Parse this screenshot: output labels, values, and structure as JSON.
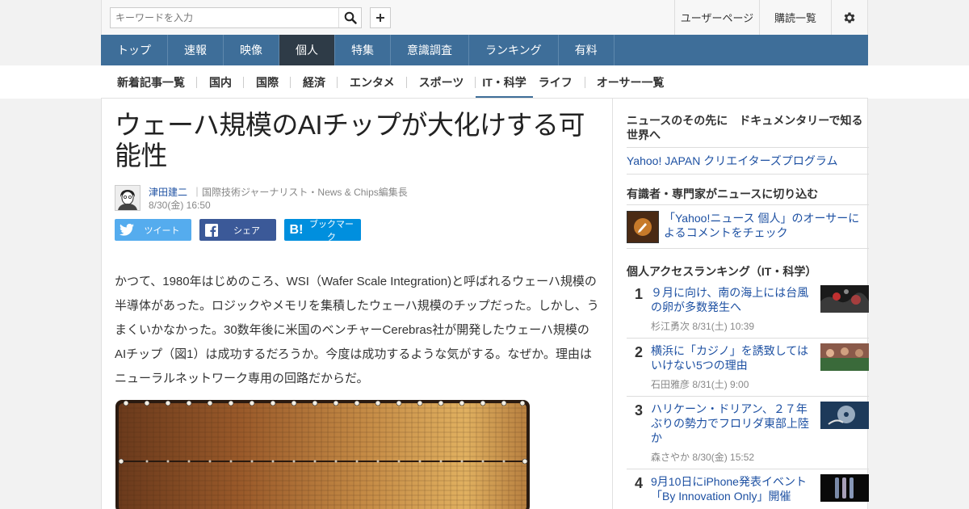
{
  "topbar": {
    "search_placeholder": "キーワードを入力",
    "user_page": "ユーザーページ",
    "subscriptions": "購読一覧"
  },
  "nav": {
    "items": [
      {
        "label": "トップ"
      },
      {
        "label": "速報"
      },
      {
        "label": "映像"
      },
      {
        "label": "個人",
        "active": true
      },
      {
        "label": "特集"
      },
      {
        "label": "意識調査"
      },
      {
        "label": "ランキング"
      },
      {
        "label": "有料"
      }
    ]
  },
  "subnav": {
    "items": [
      {
        "label": "新着記事一覧"
      },
      {
        "label": "国内"
      },
      {
        "label": "国際"
      },
      {
        "label": "経済"
      },
      {
        "label": "エンタメ"
      },
      {
        "label": "スポーツ"
      },
      {
        "label": "IT・科学",
        "active": true
      },
      {
        "label": "ライフ"
      },
      {
        "label": "オーサー一覧"
      }
    ]
  },
  "article": {
    "title": "ウェーハ規模のAIチップが大化けする可能性",
    "author_name": "津田建二",
    "author_title": "｜国際技術ジャーナリスト・News & Chips編集長",
    "date": "8/30(金) 16:50",
    "share_tweet": "ツイート",
    "share_facebook": "シェア",
    "share_bookmark": "ブックマーク",
    "body": "かつて、1980年はじめのころ、WSI（Wafer Scale Integration)と呼ばれるウェーハ規模の半導体があった。ロジックやメモリを集積したウェーハ規模のチップだった。しかし、うまくいかなかった。30数年後に米国のベンチャーCerebras社が開発したウェーハ規模のAIチップ（図1）は成功するだろうか。今度は成功するような気がする。なぜか。理由はニューラルネットワーク専用の回路だからだ。"
  },
  "sidebar": {
    "block1_head": "ニュースのその先に　ドキュメンタリーで知る世界へ",
    "block1_link": "Yahoo! JAPAN クリエイターズプログラム",
    "block2_head": "有識者・専門家がニュースに切り込む",
    "block2_promo": "「Yahoo!ニュース 個人」のオーサーによるコメントをチェック",
    "ranking_head": "個人アクセスランキング（IT・科学）",
    "ranking": [
      {
        "rank": "1",
        "title": "９月に向け、南の海上には台風の卵が多数発生へ",
        "author": "杉江勇次",
        "date": "8/31(土) 10:39"
      },
      {
        "rank": "2",
        "title": "横浜に「カジノ」を誘致してはいけない5つの理由",
        "author": "石田雅彦",
        "date": "8/31(土) 9:00"
      },
      {
        "rank": "3",
        "title": "ハリケーン・ドリアン、２７年ぶりの勢力でフロリダ東部上陸か",
        "author": "森さやか",
        "date": "8/30(金) 15:52"
      },
      {
        "rank": "4",
        "title": "9月10日にiPhone発表イベント「By Innovation Only」開催",
        "author": "",
        "date": ""
      }
    ]
  },
  "colors": {
    "nav_bg": "#3e6e99",
    "nav_active": "#2e3b47",
    "link": "#1d50a2",
    "twitter": "#55acee",
    "facebook": "#3b5998",
    "hatena": "#008fde"
  }
}
